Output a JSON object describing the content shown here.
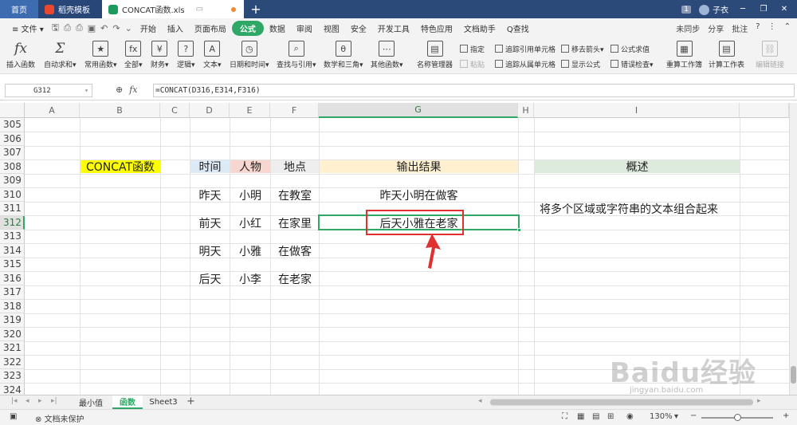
{
  "titlebar": {
    "tabs": [
      {
        "label": "首页"
      },
      {
        "label": "稻壳模板"
      },
      {
        "label": "CONCAT函数.xls"
      }
    ],
    "new_tab": "+",
    "badge": "1",
    "user": "子衣"
  },
  "menubar": {
    "file": "≡ 文件 ▾",
    "items": [
      "开始",
      "插入",
      "页面布局",
      "公式",
      "数据",
      "审阅",
      "视图",
      "安全",
      "开发工具",
      "特色应用",
      "文档助手",
      "Q查找"
    ],
    "active": "公式",
    "sync": "未同步",
    "share": "分享",
    "comment": "批注"
  },
  "ribbon": {
    "buttons": [
      {
        "label": "插入函数",
        "icon": "fx"
      },
      {
        "label": "自动求和▾",
        "icon": "Σ"
      },
      {
        "label": "常用函数▾",
        "icon": "★"
      },
      {
        "label": "全部▾",
        "icon": "fx"
      },
      {
        "label": "财务▾",
        "icon": "¥"
      },
      {
        "label": "逻辑▾",
        "icon": "?"
      },
      {
        "label": "文本▾",
        "icon": "A"
      },
      {
        "label": "日期和时间▾",
        "icon": "◷"
      },
      {
        "label": "查找与引用▾",
        "icon": "⌕"
      },
      {
        "label": "数学和三角▾",
        "icon": "θ"
      },
      {
        "label": "其他函数▾",
        "icon": "⋯"
      },
      {
        "label": "名称管理器",
        "icon": "▤"
      }
    ],
    "small": {
      "specify": "指定",
      "paste": "粘贴",
      "trace_precedents": "追踪引用单元格",
      "trace_dependents": "追踪从属单元格",
      "remove_arrows": "移去箭头▾",
      "show_formulas": "显示公式",
      "evaluate": "公式求值",
      "error_check": "错误检查▾"
    },
    "big_right": [
      {
        "label": "重算工作簿"
      },
      {
        "label": "计算工作表"
      },
      {
        "label": "编辑链接"
      }
    ]
  },
  "formula_bar": {
    "cell_ref": "G312",
    "formula": "=CONCAT(D316,E314,F316)"
  },
  "columns": [
    "A",
    "B",
    "C",
    "D",
    "E",
    "F",
    "G",
    "H",
    "I"
  ],
  "rows": [
    "305",
    "306",
    "307",
    "308",
    "309",
    "310",
    "311",
    "312",
    "313",
    "314",
    "315",
    "316",
    "317",
    "318",
    "319",
    "320",
    "321",
    "322",
    "323",
    "324"
  ],
  "cells": {
    "b308": "CONCAT函数",
    "d308": "时间",
    "e308": "人物",
    "f308": "地点",
    "g308": "输出结果",
    "i308": "概述",
    "d310": "昨天",
    "e310": "小明",
    "f310": "在教室",
    "g310": "昨天小明在做客",
    "i311": "将多个区域或字符串的文本组合起来",
    "d312": "前天",
    "e312": "小红",
    "f312": "在家里",
    "g312": "后天小雅在老家",
    "d314": "明天",
    "e314": "小雅",
    "f314": "在做客",
    "d316": "后天",
    "e316": "小李",
    "f316": "在老家"
  },
  "colors": {
    "b308": "#ffff00",
    "d308": "#dce9f7",
    "e308": "#f8d7d0",
    "f308": "#eeeeee",
    "g308": "#fff0d0",
    "i308": "#dcebdc",
    "accent": "#2fa867",
    "annotation": "#e03030"
  },
  "sheets": [
    "最小值",
    "函数",
    "Sheet3"
  ],
  "active_sheet": "函数",
  "status": {
    "protect": "文档未保护",
    "zoom": "130%"
  },
  "watermark": {
    "logo": "Baidu经验",
    "url": "jingyan.baidu.com"
  }
}
